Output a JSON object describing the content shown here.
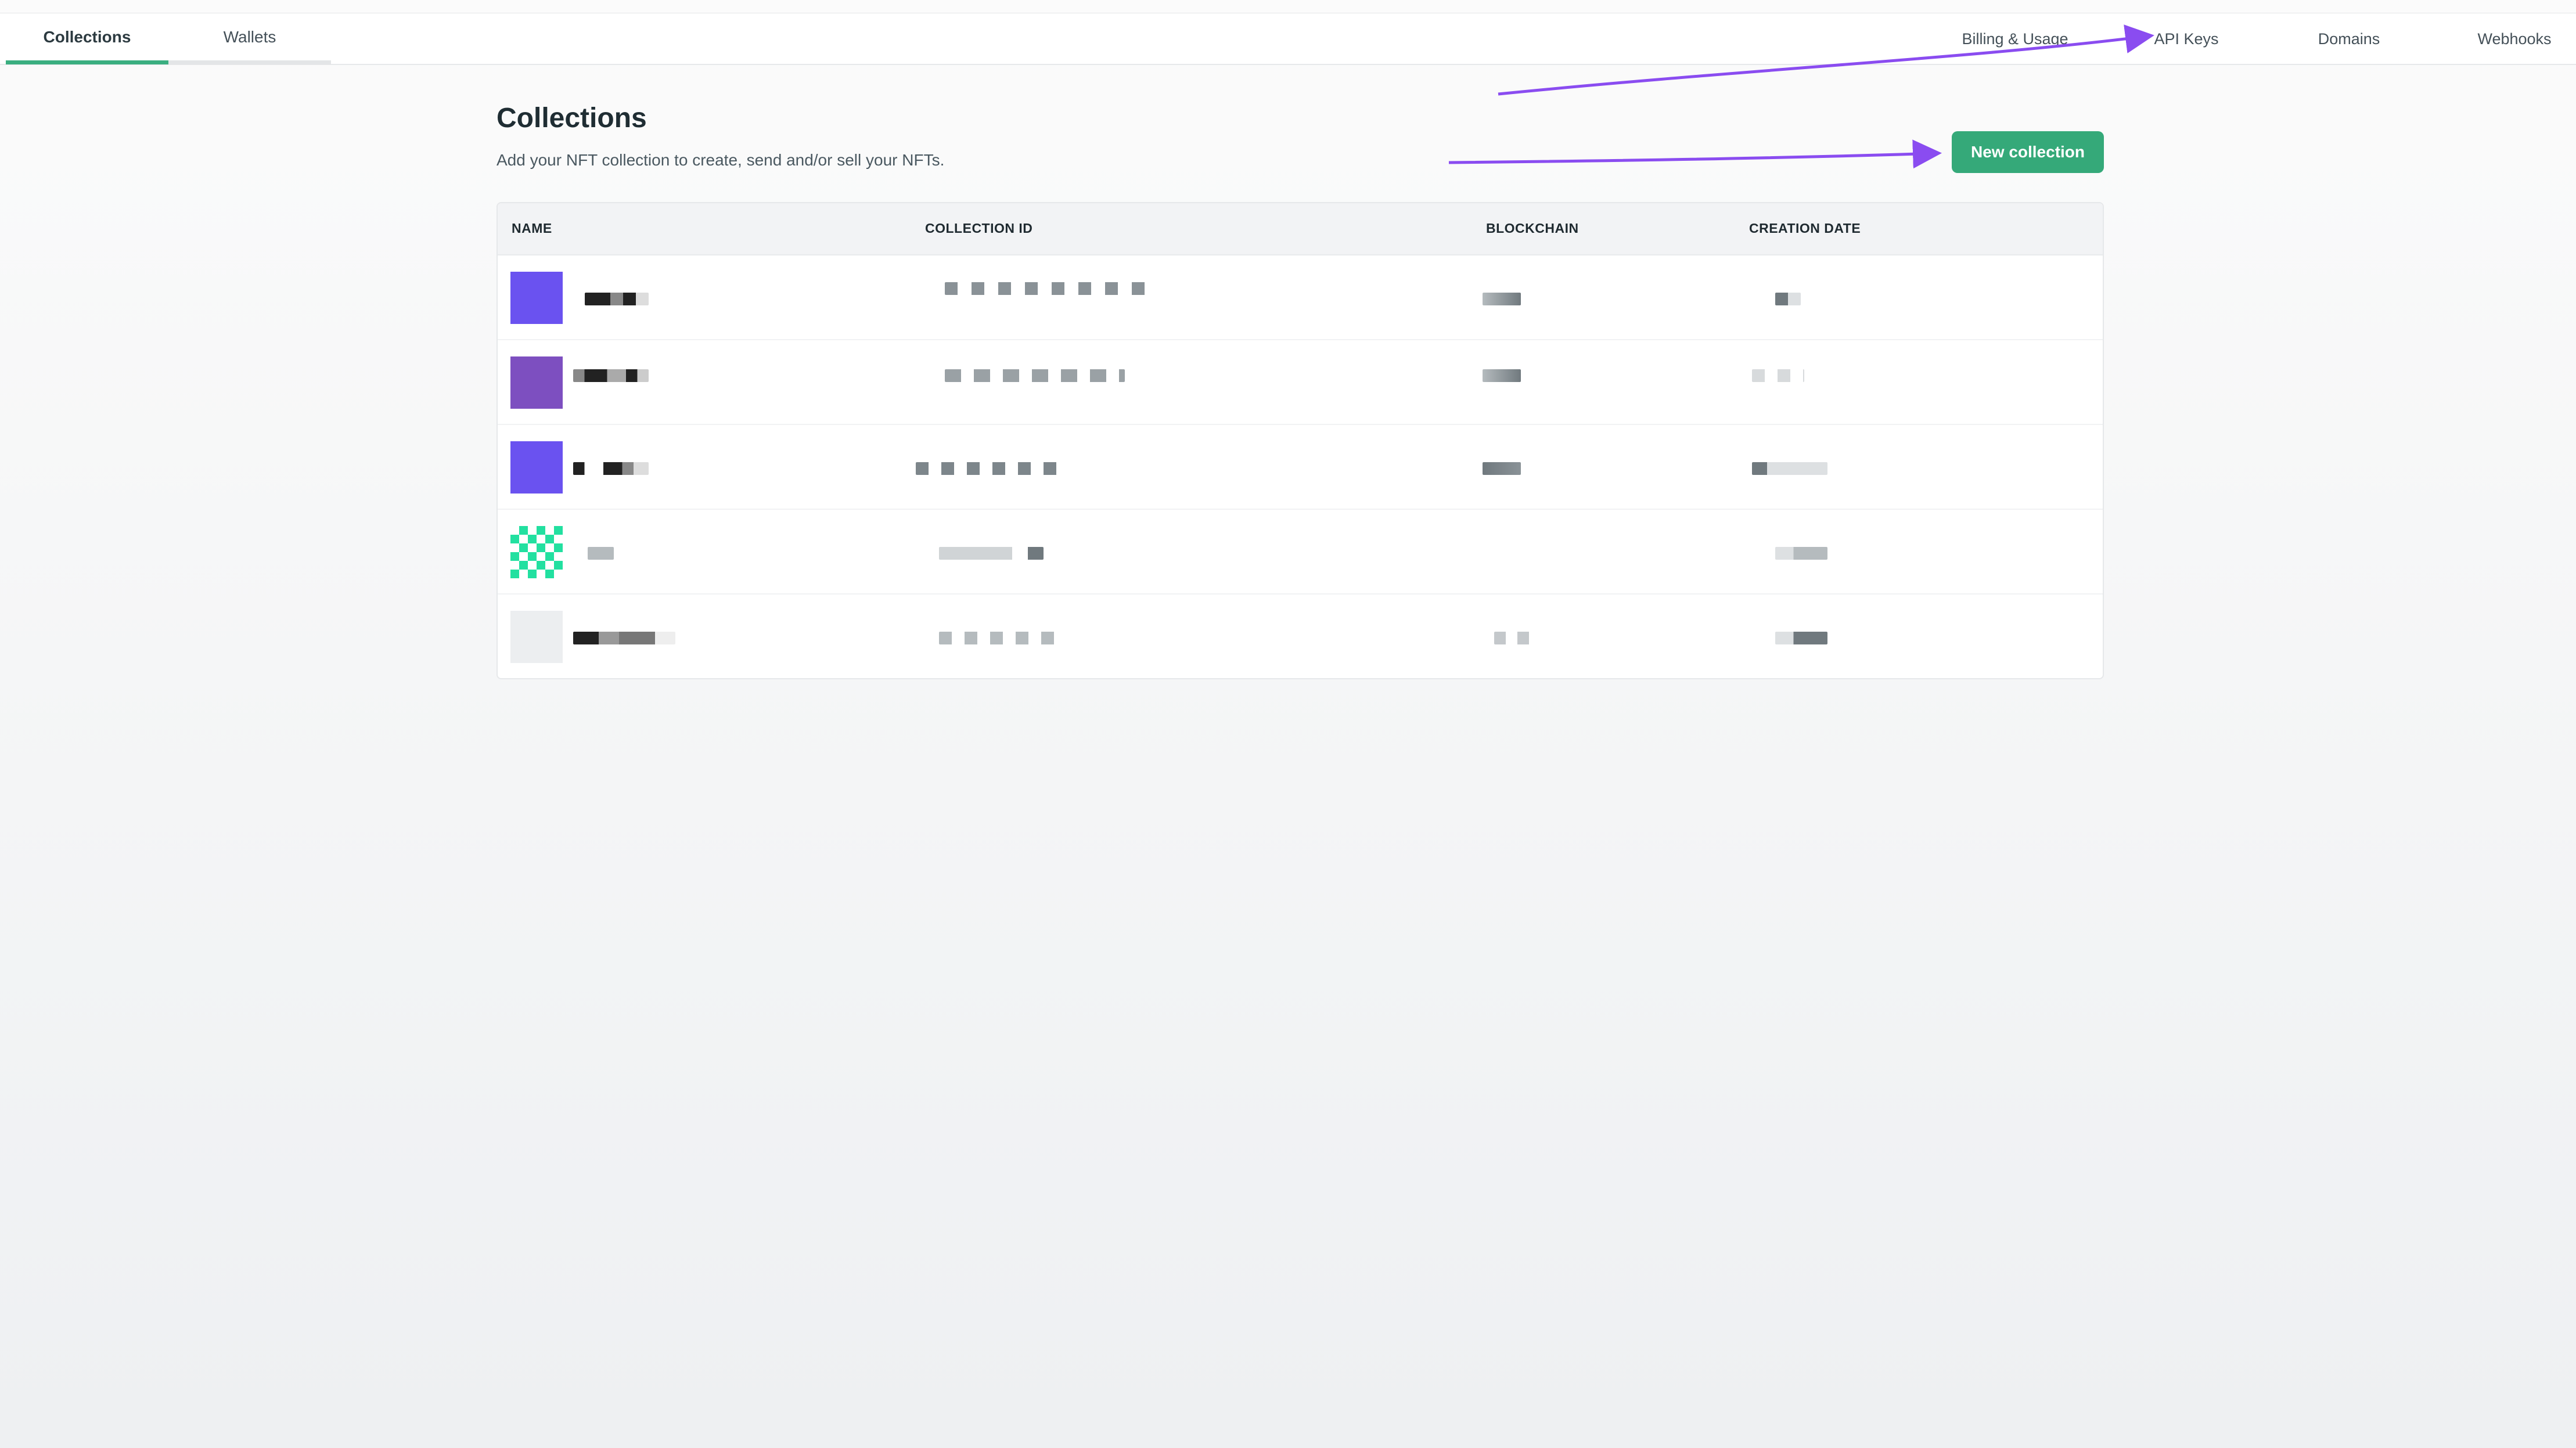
{
  "topbar": {
    "left_tabs": [
      {
        "label": "Collections",
        "active": true
      },
      {
        "label": "Wallets",
        "active": false
      }
    ],
    "right_links": [
      {
        "label": "Billing & Usage"
      },
      {
        "label": "API Keys"
      },
      {
        "label": "Domains"
      },
      {
        "label": "Webhooks"
      }
    ]
  },
  "page": {
    "title": "Collections",
    "subtitle": "Add your NFT collection to create, send and/or sell your NFTs.",
    "new_button_label": "New collection"
  },
  "table": {
    "columns": [
      "NAME",
      "COLLECTION ID",
      "BLOCKCHAIN",
      "CREATION DATE"
    ],
    "rows": [
      {
        "name": "",
        "collection_id": "",
        "blockchain": "",
        "creation_date": "",
        "thumb_color": "#6a52f0"
      },
      {
        "name": "",
        "collection_id": "",
        "blockchain": "",
        "creation_date": "",
        "thumb_color": "#7d4fc0"
      },
      {
        "name": "",
        "collection_id": "",
        "blockchain": "",
        "creation_date": "",
        "thumb_color": "#6a52f0"
      },
      {
        "name": "",
        "collection_id": "",
        "blockchain": "",
        "creation_date": "",
        "thumb_color": "#22e0a0"
      },
      {
        "name": "",
        "collection_id": "",
        "blockchain": "",
        "creation_date": "",
        "thumb_color": "#eceef0"
      }
    ]
  },
  "colors": {
    "accent": "#35a979",
    "annotation_arrow": "#8a4cf0"
  }
}
